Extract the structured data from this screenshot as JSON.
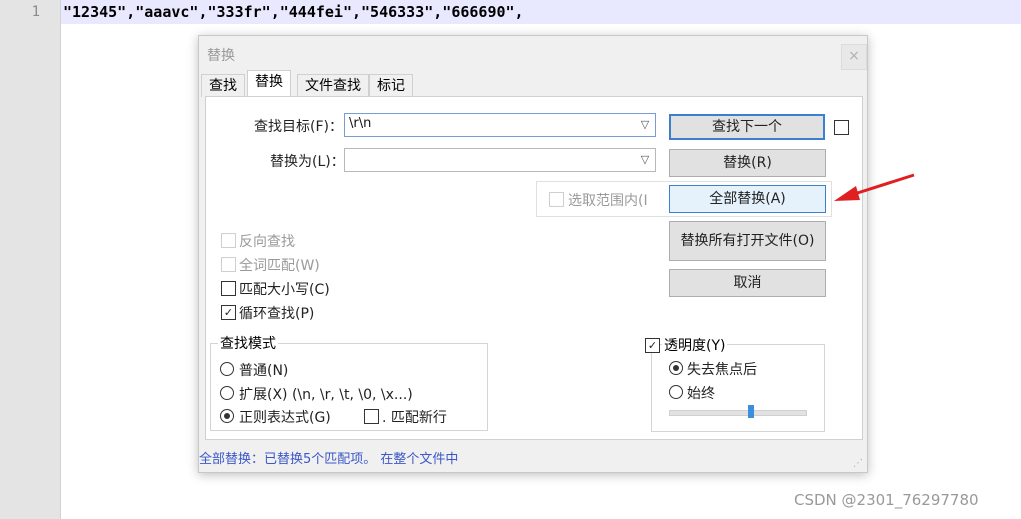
{
  "editor": {
    "line_number": "1",
    "line_text": "\"12345\",\"aaavc\",\"333fr\",\"444fei\",\"546333\",\"666690\","
  },
  "dialog": {
    "title": "替换",
    "close_glyph": "×",
    "tabs": [
      {
        "label": "查找",
        "active": false
      },
      {
        "label": "替换",
        "active": true
      },
      {
        "label": "文件查找",
        "active": false
      },
      {
        "label": "标记",
        "active": false
      }
    ],
    "find_label": "查找目标(F)：",
    "find_value": "\\r\\n",
    "replace_label": "替换为(L)：",
    "replace_value": "",
    "in_selection_label": "选取范围内(I",
    "buttons": {
      "find_next": "查找下一个",
      "replace": "替换(R)",
      "replace_all": "全部替换(A)",
      "replace_all_open": "替换所有打开文件(O)",
      "cancel": "取消"
    },
    "options": {
      "backward": "反向查找",
      "whole_word": "全词匹配(W)",
      "match_case": "匹配大小写(C)",
      "wrap_around": "循环查找(P)"
    },
    "search_mode": {
      "title": "查找模式",
      "normal": "普通(N)",
      "extended": "扩展(X) (\\n, \\r, \\t, \\0, \\x...)",
      "regex": "正则表达式(G)",
      "dot_newline": ". 匹配新行"
    },
    "transparency": {
      "title": "透明度(Y)",
      "on_lose_focus": "失去焦点后",
      "always": "始终",
      "level_fraction": 0.6
    },
    "status": "全部替换：已替换5个匹配项。 在整个文件中"
  },
  "watermark": "CSDN @2301_76297780",
  "colors": {
    "accent": "#3c7fd1",
    "status_text": "#3b57c8",
    "arrow": "#e02020",
    "line_highlight": "#e8e8ff"
  }
}
